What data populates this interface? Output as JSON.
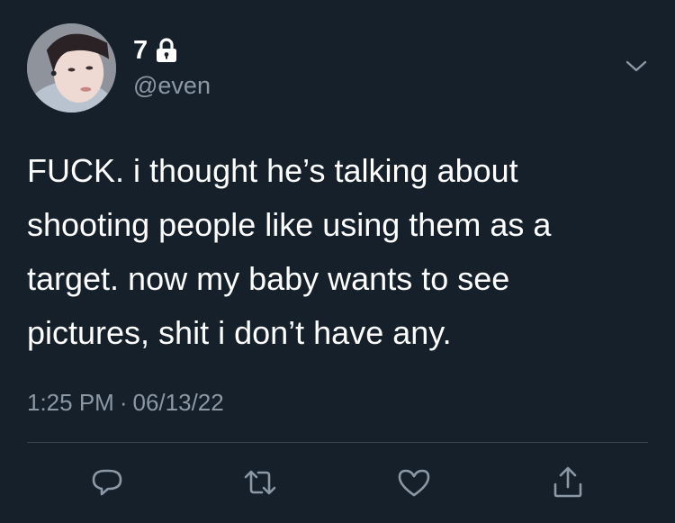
{
  "tweet": {
    "display_name": "7",
    "handle": "@even",
    "text": "FUCK. i thought he’s talking about\nshooting people like using them as a\ntarget. now my baby wants to see\npictures, shit i don’t have any.",
    "time": "1:25 PM",
    "separator": "·",
    "date": "06/13/22"
  },
  "icons": {
    "lock": "lock-icon",
    "more": "chevron-down-icon",
    "reply": "reply-icon",
    "retweet": "retweet-icon",
    "like": "heart-icon",
    "share": "share-icon"
  },
  "colors": {
    "background": "#15202b",
    "text_primary": "#ffffff",
    "text_secondary": "#8b98a5",
    "divider": "#38444d"
  }
}
